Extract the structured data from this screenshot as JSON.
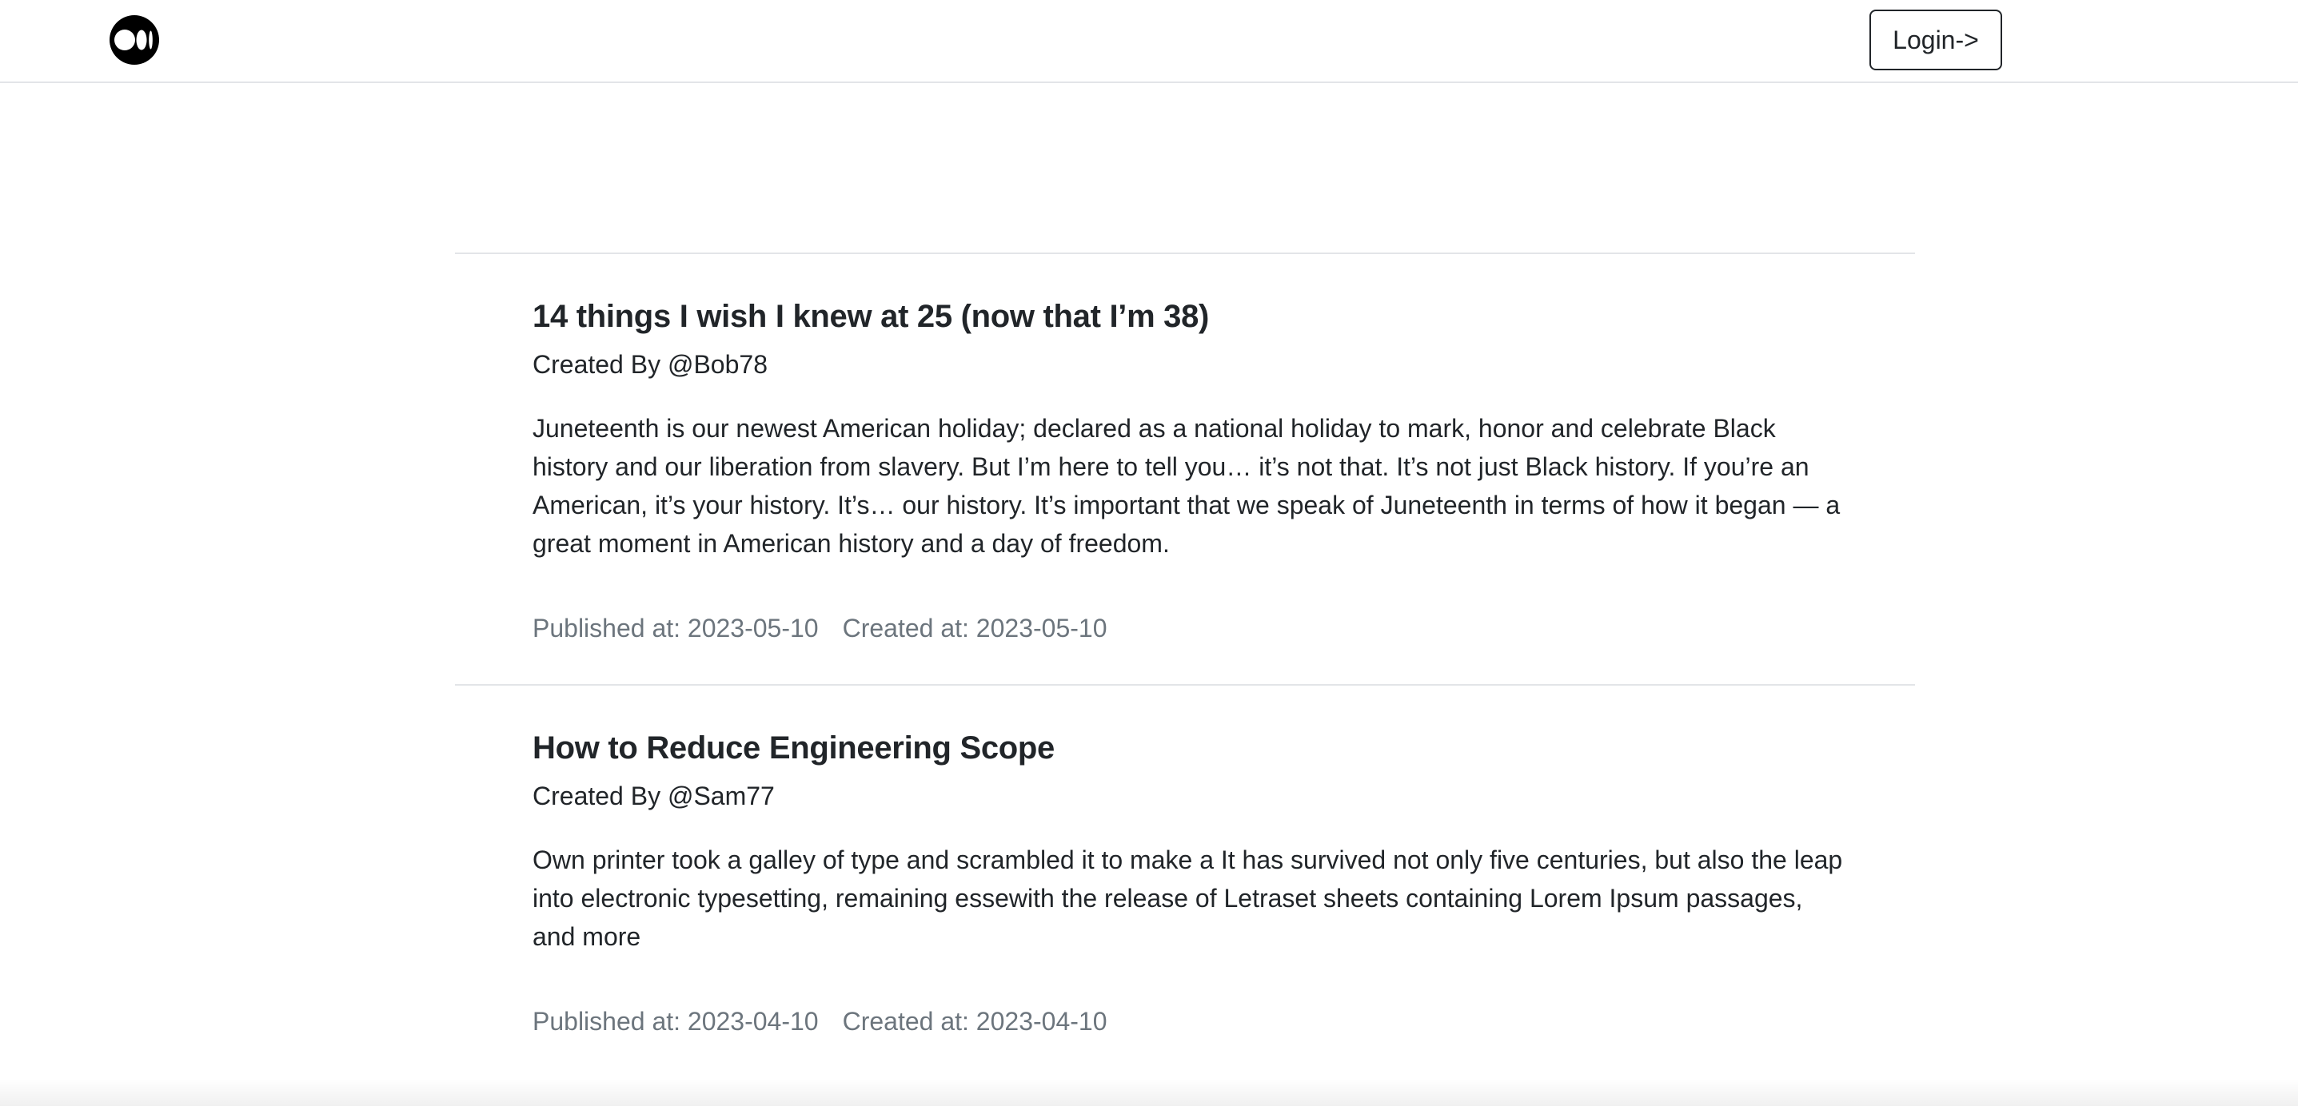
{
  "header": {
    "logo_icon": "medium-logo-icon",
    "login_label": "Login->"
  },
  "posts": [
    {
      "title": "14 things I wish I knew at 25 (now that I’m 38)",
      "author": "Created By @Bob78",
      "excerpt": "Juneteenth is our newest American holiday; declared as a national holiday to mark, honor and celebrate Black history and our liberation from slavery. But I’m here to tell you… it’s not that. It’s not just Black history. If you’re an American, it’s your history. It’s… our history. It’s important that we speak of Juneteenth in terms of how it began — a great moment in American history and a day of freedom.",
      "published": "Published at: 2023-05-10",
      "created": "Created at: 2023-05-10"
    },
    {
      "title": "How to Reduce Engineering Scope",
      "author": "Created By @Sam77",
      "excerpt": "Own printer took a galley of type and scrambled it to make a It has survived not only five centuries, but also the leap into electronic typesetting, remaining essewith the release of Letraset sheets containing Lorem Ipsum passages, and more",
      "published": "Published at: 2023-04-10",
      "created": "Created at: 2023-04-10"
    }
  ],
  "colors": {
    "text": "#212529",
    "muted": "#6c757d",
    "divider": "#e3e5e8"
  }
}
